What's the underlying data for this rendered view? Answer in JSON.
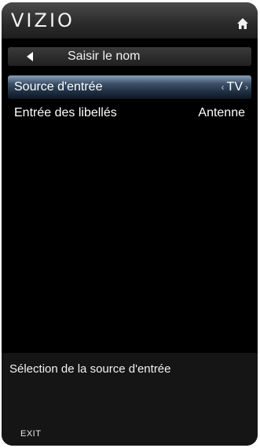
{
  "header": {
    "logo": "VIZIO",
    "home_icon": "home-icon"
  },
  "nav": {
    "title": "Saisir le nom",
    "back_icon": "back-arrow-icon"
  },
  "menu": {
    "items": [
      {
        "label": "Source d'entrée",
        "value": "TV",
        "selected": true
      },
      {
        "label": "Entrée des libellés",
        "value": "Antenne",
        "selected": false
      }
    ],
    "arrows": {
      "left": "‹",
      "right": "›"
    }
  },
  "help": {
    "text": "Sélection de la source d'entrée"
  },
  "footer": {
    "exit_label": "EXIT"
  },
  "colors": {
    "background": "#000000",
    "selected_row": "#3c5068",
    "text": "#ffffff"
  }
}
